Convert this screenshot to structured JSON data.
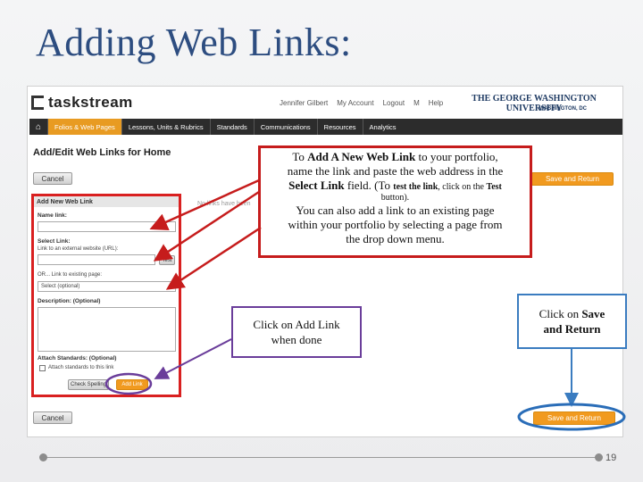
{
  "slide": {
    "title": "Adding Web Links:",
    "page_number": "19"
  },
  "screenshot": {
    "logo_text": "taskstream",
    "header_links": [
      "Jennifer Gilbert",
      "My Account",
      "Logout",
      "M",
      "Help"
    ],
    "university_name": "THE GEORGE WASHINGTON UNIVERSITY",
    "university_city": "WASHINGTON, DC",
    "nav": {
      "home_icon": "home-icon",
      "items": [
        {
          "label": "Folios & Web Pages",
          "active": true
        },
        {
          "label": "Lessons, Units & Rubrics",
          "active": false
        },
        {
          "label": "Standards",
          "active": false
        },
        {
          "label": "Communications",
          "active": false
        },
        {
          "label": "Resources",
          "active": false
        },
        {
          "label": "Analytics",
          "active": false
        }
      ]
    },
    "page_heading": "Add/Edit Web Links for Home",
    "cancel_label": "Cancel",
    "save_return_label": "Save and Return",
    "faded_text": "No links have been",
    "form": {
      "header": "Add New Web Link",
      "name_label": "Name link:",
      "select_label": "Select Link:",
      "external_label": "Link to an external website (URL):",
      "test_label": "Test",
      "existing_label": "OR... Link to existing page:",
      "select_value": "Select (optional)",
      "description_label": "Description: (Optional)",
      "attach_label": "Attach Standards: (Optional)",
      "attach_checkbox_label": "Attach standards to this link",
      "check_spelling_label": "Check Spelling",
      "add_link_label": "Add Link"
    }
  },
  "callouts": {
    "main": {
      "line1_pre": "To ",
      "line1_bold": "Add A New Web Link",
      "line1_post": " to your portfolio,",
      "line2": "name the link and paste the web address in the",
      "line3_bold": "Select Link",
      "line3_post": "  field. (To ",
      "line3_bold2": "test the link",
      "line3_post2": ", click on the ",
      "line3_bold3": "Test",
      "line4": "button).",
      "line5": "You can also add a link to an existing page",
      "line6": "within your portfolio by selecting a page from",
      "line7": "the drop down menu."
    },
    "add_link": {
      "pre": "Click on ",
      "bold": "Add Link",
      "post": "when done"
    },
    "save": {
      "pre": "Click on ",
      "bold1": "Save",
      "bold2": "and Return"
    }
  },
  "colors": {
    "title": "#2d4d80",
    "red_highlight": "#d92020",
    "purple": "#6a3d9a",
    "blue": "#3a7cc0",
    "orange_button": "#f19a1f"
  }
}
